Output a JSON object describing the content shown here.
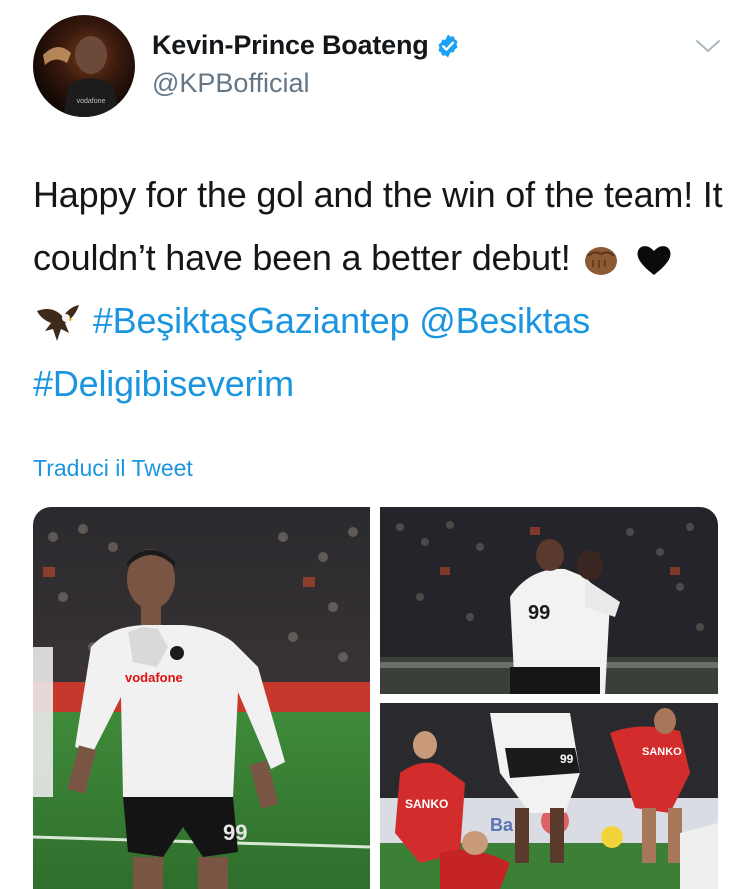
{
  "author": {
    "display_name": "Kevin-Prince Boateng",
    "handle": "@KPBofficial",
    "verified": true,
    "avatar_icon": "player-portrait-avatar"
  },
  "tweet": {
    "text_plain": "Happy for the gol and the win of the team! It couldn’t have been a better debut!",
    "emojis": [
      "flexed-fist-emoji",
      "black-heart-emoji",
      "eagle-emoji"
    ],
    "hashtag_1": "#BeşiktaşGaziantep",
    "mention": "@Besiktas",
    "hashtag_2": "#Deligibiseverim"
  },
  "translate_label": "Traduci il Tweet",
  "media": {
    "photos": [
      {
        "icon": "player-celebration-photo",
        "jersey_number": "99",
        "sponsor": "vodafone"
      },
      {
        "icon": "players-hugging-photo",
        "jersey_number": "99"
      },
      {
        "icon": "match-action-photo",
        "jersey_number": "99",
        "opponent_sponsor": "SANKO"
      }
    ]
  },
  "colors": {
    "link": "#1b95e0",
    "secondary_text": "#657786",
    "primary_text": "#14171a",
    "verified_badge": "#1da1f2"
  }
}
